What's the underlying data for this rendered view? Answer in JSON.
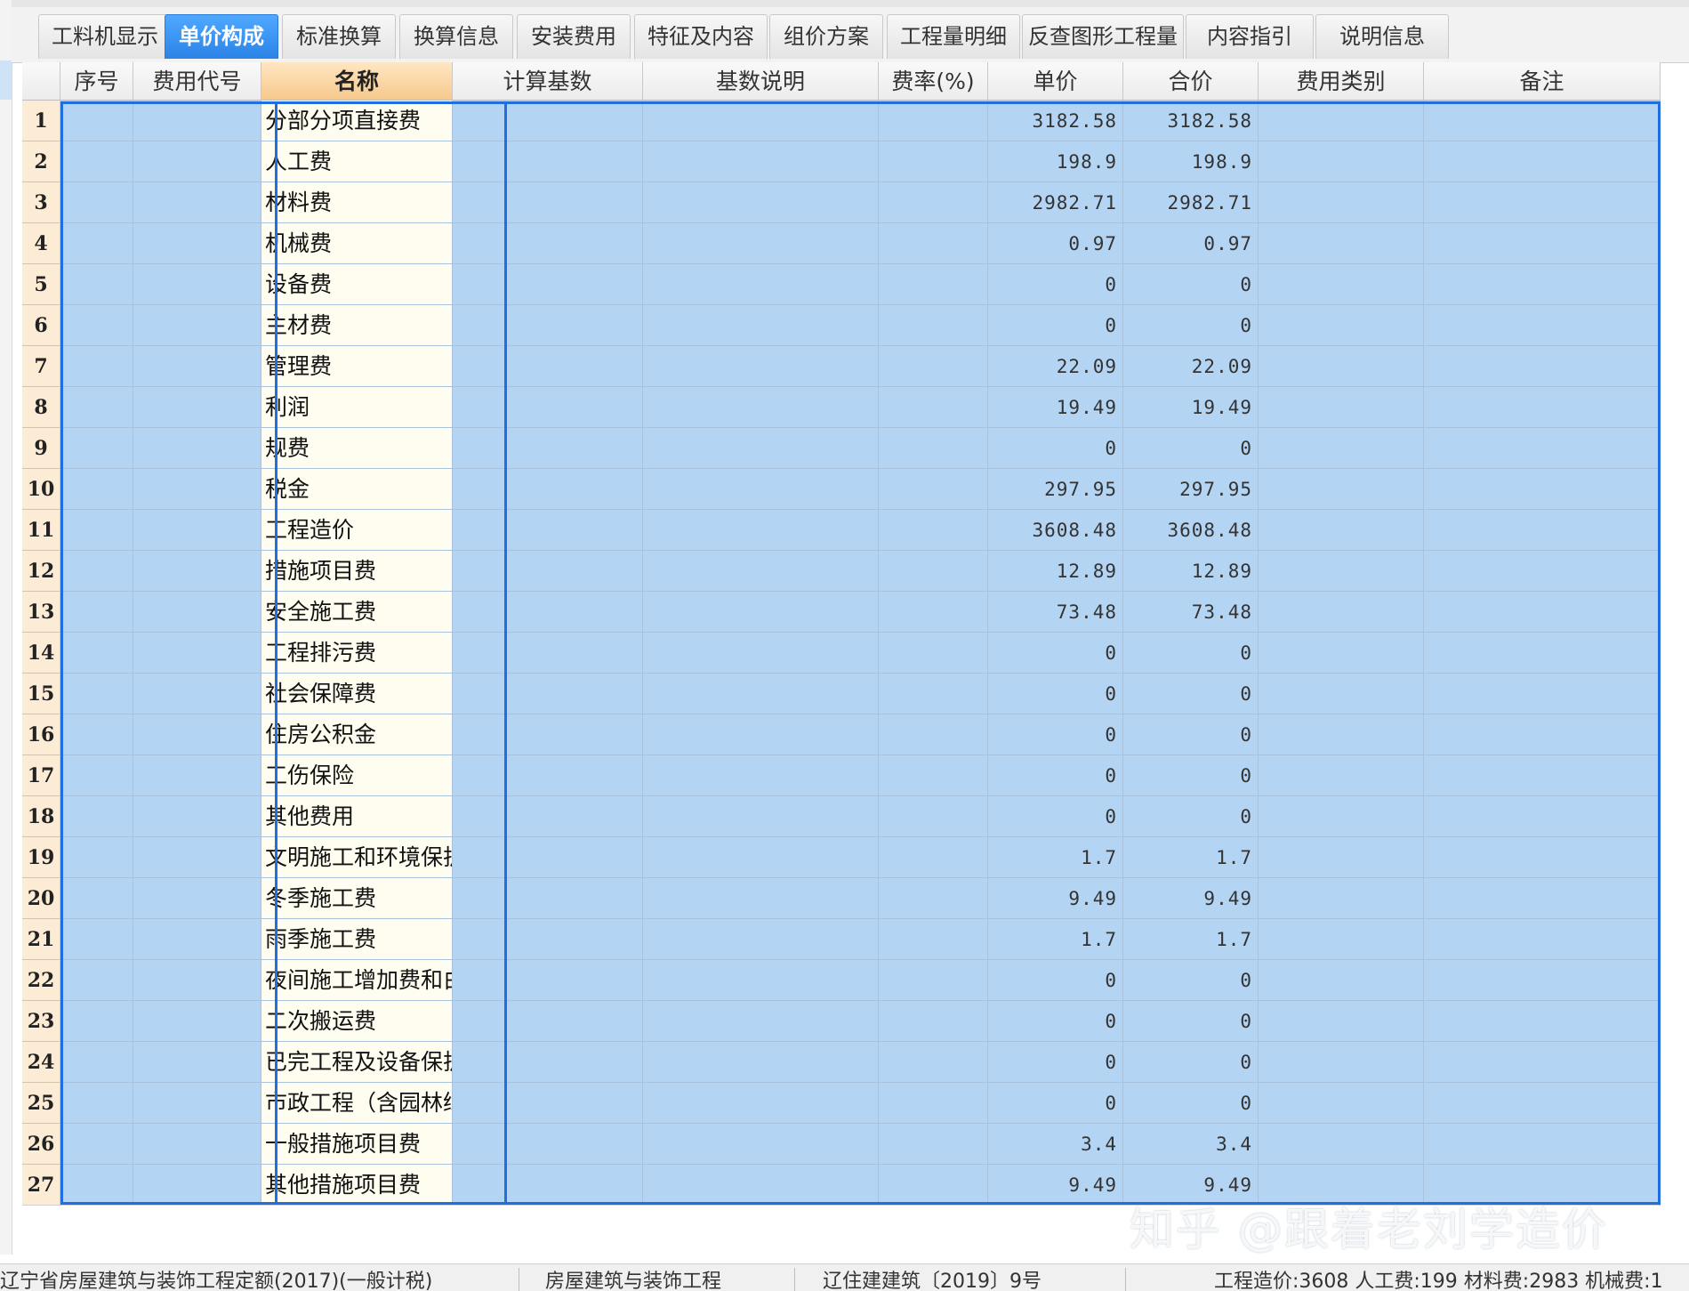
{
  "tabs": [
    {
      "label": "工料机显示",
      "active": false
    },
    {
      "label": "单价构成",
      "active": true
    },
    {
      "label": "标准换算",
      "active": false
    },
    {
      "label": "换算信息",
      "active": false
    },
    {
      "label": "安装费用",
      "active": false
    },
    {
      "label": "特征及内容",
      "active": false
    },
    {
      "label": "组价方案",
      "active": false
    },
    {
      "label": "工程量明细",
      "active": false
    },
    {
      "label": "反查图形工程量",
      "active": false
    },
    {
      "label": "内容指引",
      "active": false
    },
    {
      "label": "说明信息",
      "active": false
    }
  ],
  "table": {
    "columns": [
      "序号",
      "费用代号",
      "名称",
      "计算基数",
      "基数说明",
      "费率(%)",
      "单价",
      "合价",
      "费用类别",
      "备注"
    ],
    "selected_column": "名称",
    "rows": [
      {
        "num": "1",
        "name": "分部分项直接费",
        "unit": "3182.58",
        "total": "3182.58"
      },
      {
        "num": "2",
        "name": "人工费",
        "unit": "198.9",
        "total": "198.9"
      },
      {
        "num": "3",
        "name": "材料费",
        "unit": "2982.71",
        "total": "2982.71"
      },
      {
        "num": "4",
        "name": "机械费",
        "unit": "0.97",
        "total": "0.97"
      },
      {
        "num": "5",
        "name": "设备费",
        "unit": "0",
        "total": "0"
      },
      {
        "num": "6",
        "name": "主材费",
        "unit": "0",
        "total": "0"
      },
      {
        "num": "7",
        "name": "管理费",
        "unit": "22.09",
        "total": "22.09"
      },
      {
        "num": "8",
        "name": "利润",
        "unit": "19.49",
        "total": "19.49"
      },
      {
        "num": "9",
        "name": "规费",
        "unit": "0",
        "total": "0"
      },
      {
        "num": "10",
        "name": "税金",
        "unit": "297.95",
        "total": "297.95"
      },
      {
        "num": "11",
        "name": "工程造价",
        "unit": "3608.48",
        "total": "3608.48"
      },
      {
        "num": "12",
        "name": "措施项目费",
        "unit": "12.89",
        "total": "12.89"
      },
      {
        "num": "13",
        "name": "安全施工费",
        "unit": "73.48",
        "total": "73.48"
      },
      {
        "num": "14",
        "name": "工程排污费",
        "unit": "0",
        "total": "0"
      },
      {
        "num": "15",
        "name": "社会保障费",
        "unit": "0",
        "total": "0"
      },
      {
        "num": "16",
        "name": "住房公积金",
        "unit": "0",
        "total": "0"
      },
      {
        "num": "17",
        "name": "工伤保险",
        "unit": "0",
        "total": "0"
      },
      {
        "num": "18",
        "name": "其他费用",
        "unit": "0",
        "total": "0"
      },
      {
        "num": "19",
        "name": "文明施工和环境保护费",
        "unit": "1.7",
        "total": "1.7"
      },
      {
        "num": "20",
        "name": "冬季施工费",
        "unit": "9.49",
        "total": "9.49"
      },
      {
        "num": "21",
        "name": "雨季施工费",
        "unit": "1.7",
        "total": "1.7"
      },
      {
        "num": "22",
        "name": "夜间施工增加费和白…",
        "unit": "0",
        "total": "0"
      },
      {
        "num": "23",
        "name": "二次搬运费",
        "unit": "0",
        "total": "0"
      },
      {
        "num": "24",
        "name": "已完工程及设备保护费",
        "unit": "0",
        "total": "0"
      },
      {
        "num": "25",
        "name": "市政工程（含园林绿…",
        "unit": "0",
        "total": "0"
      },
      {
        "num": "26",
        "name": "一般措施项目费",
        "unit": "3.4",
        "total": "3.4"
      },
      {
        "num": "27",
        "name": "其他措施项目费",
        "unit": "9.49",
        "total": "9.49"
      }
    ]
  },
  "status_bar": {
    "item1": "辽宁省房屋建筑与装饰工程定额(2017)(一般计税)",
    "item2": "房屋建筑与装饰工程",
    "item3": "辽住建建筑〔2019〕9号",
    "item4": "工程造价:3608   人工费:199   材料费:2983   机械费:1"
  },
  "watermark": "知乎 @跟着老刘学造价",
  "colors": {
    "active_tab": "#2a83e6",
    "selection_fill": "#b4d4f3",
    "selection_border": "#1f6fe0",
    "name_column_fill": "#fffdf0",
    "row_number_fill": "#fdecd5",
    "selected_header_fill": "#f7c98c"
  }
}
